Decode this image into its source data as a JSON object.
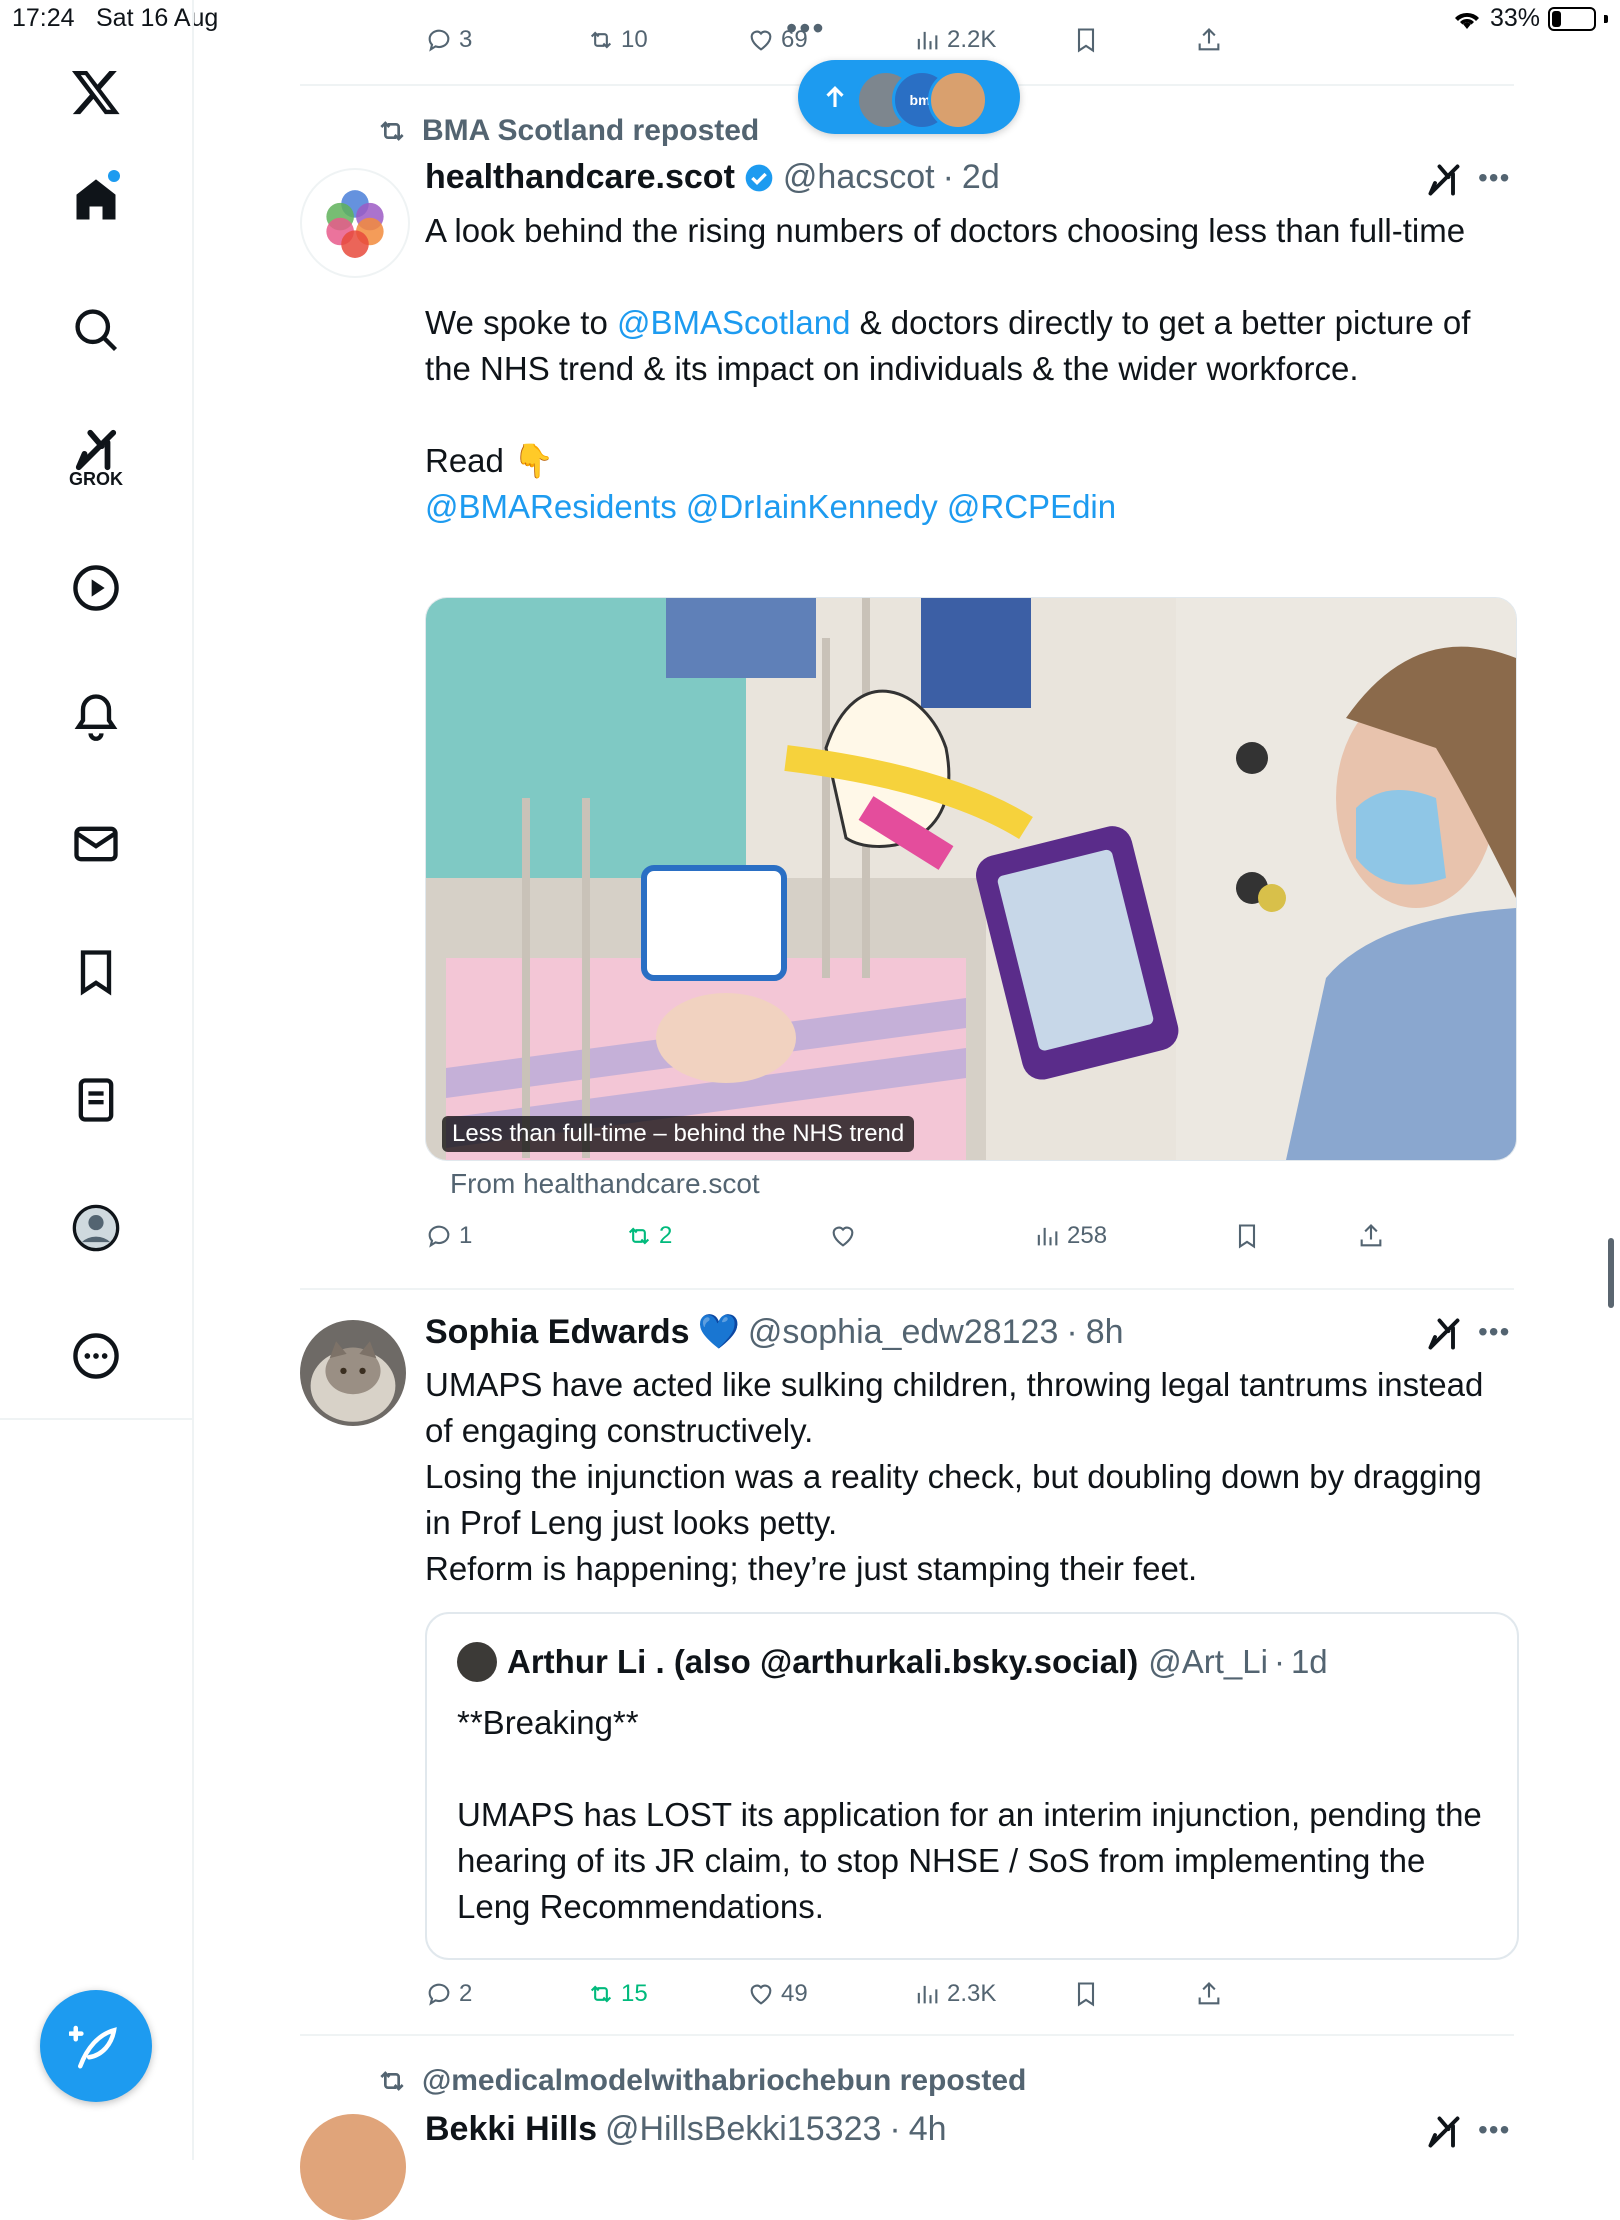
{
  "status_bar": {
    "time": "17:24",
    "date": "Sat 16 Aug",
    "battery": "33%",
    "battery_level": 0.33
  },
  "sidebar": {
    "items": [
      {
        "name": "home",
        "icon": "home-icon"
      },
      {
        "name": "explore",
        "icon": "search-icon"
      },
      {
        "name": "grok",
        "icon": "grok-icon",
        "label": "GROK"
      },
      {
        "name": "video",
        "icon": "play-icon"
      },
      {
        "name": "notifications",
        "icon": "bell-icon"
      },
      {
        "name": "messages",
        "icon": "mail-icon"
      },
      {
        "name": "bookmarks",
        "icon": "bookmark-icon"
      },
      {
        "name": "lists",
        "icon": "list-icon"
      },
      {
        "name": "profile",
        "icon": "profile-icon"
      },
      {
        "name": "more",
        "icon": "more-icon"
      }
    ]
  },
  "new_posts_pill": {
    "label": "bmj"
  },
  "previous_tweet_actions": {
    "replies": "3",
    "reposts": "10",
    "likes": "69",
    "views": "2.2K"
  },
  "tweet1": {
    "repost_label": "BMA Scotland reposted",
    "author_name": "healthandcare.scot",
    "handle": "@hacscot",
    "time": "2d",
    "verified": true,
    "text_line1": "A look behind the rising numbers of doctors choosing less than full-time",
    "text_p2_before": "We spoke to ",
    "text_p2_link": "@BMAScotland",
    "text_p2_after": " & doctors directly to get a better picture of the NHS trend & its impact on individuals & the wider workforce.",
    "text_read": "Read 👇",
    "mentions": "@BMAResidents @DrIainKennedy @RCPEdin",
    "card_caption": "Less than full-time – behind the NHS trend",
    "card_source": "From healthandcare.scot",
    "actions": {
      "replies": "1",
      "reposts": "2",
      "likes": "",
      "views": "258"
    }
  },
  "tweet2": {
    "author_name": "Sophia Edwards",
    "emoji": "💙",
    "handle": "@sophia_edw28123",
    "time": "8h",
    "text_lines": [
      "UMAPS have acted like sulking children, throwing legal tantrums instead of engaging constructively.",
      "Losing the injunction was a reality check, but doubling down by dragging in Prof Leng just looks petty.",
      "Reform is happening; they’re just stamping their feet."
    ],
    "quote": {
      "author_name": "Arthur Li . (also @arthurkali.bsky.social)",
      "handle": "@Art_Li",
      "time": "1d",
      "text_p1": "**Breaking**",
      "text_p2": "UMAPS has LOST its application for an interim injunction, pending the hearing of its JR claim, to stop NHSE / SoS from implementing the Leng Recommendations."
    },
    "actions": {
      "replies": "2",
      "reposts": "15",
      "likes": "49",
      "views": "2.3K"
    }
  },
  "tweet3": {
    "repost_label": "@medicalmodelwithabriochebun reposted",
    "author_name": "Bekki Hills",
    "handle": "@HillsBekki15323",
    "time": "4h"
  },
  "colors": {
    "accent": "#1d9bf0",
    "repost_green": "#00ba7c",
    "muted": "#536471",
    "text": "#0f1419"
  }
}
